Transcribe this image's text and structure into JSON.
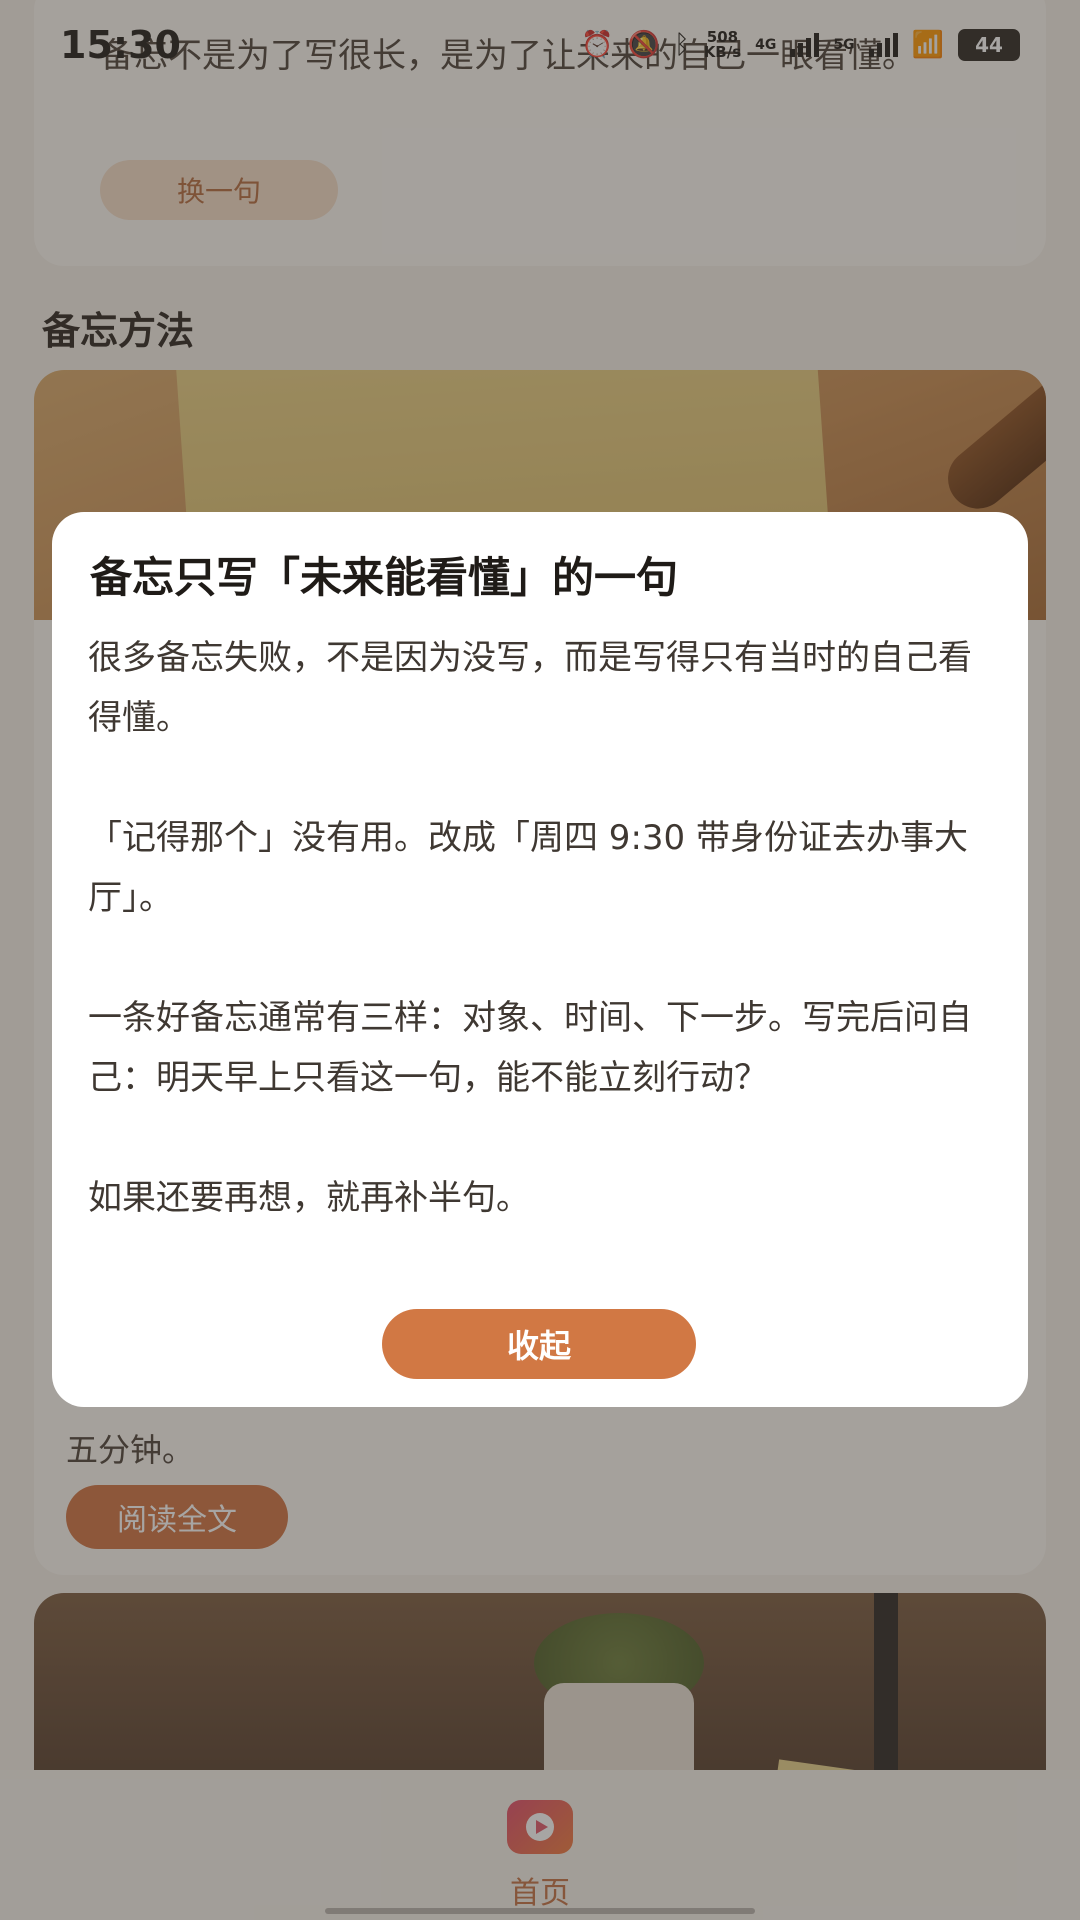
{
  "status_bar": {
    "time": "15:30",
    "net_speed_value": "508",
    "net_speed_unit": "KB/s",
    "network_1": "4G",
    "network_2": "5G",
    "battery": "44"
  },
  "quote_card": {
    "text": "备忘不是为了写很长，是为了让未来的自己一眼看懂。",
    "button_label": "换一句"
  },
  "section": {
    "title": "备忘方法"
  },
  "article_card": {
    "tail_text": "五分钟。",
    "read_button_label": "阅读全文"
  },
  "dialog": {
    "title": "备忘只写「未来能看懂」的一句",
    "paragraphs": [
      "很多备忘失败，不是因为没写，而是写得只有当时的自己看得懂。",
      "「记得那个」没有用。改成「周四 9:30 带身份证去办事大厅」。",
      "一条好备忘通常有三样：对象、时间、下一步。写完后问自己：明天早上只看这一句，能不能立刻行动？",
      "如果还要再想，就再补半句。"
    ],
    "collapse_label": "收起"
  },
  "tab_bar": {
    "home_label": "首页",
    "home_icon": "play-icon"
  },
  "colors": {
    "accent": "#d17844",
    "overlay": "rgba(60,55,52,0.45)",
    "dialog_bg": "#ffffff"
  }
}
